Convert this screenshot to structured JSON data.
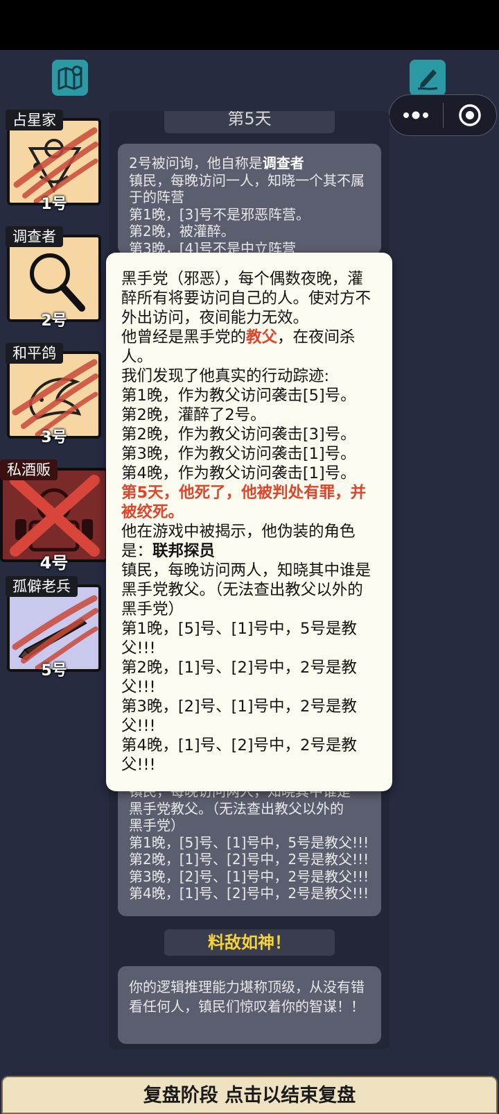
{
  "colors": {
    "background": "#262b40",
    "icon_teal": "#2b9aa5",
    "popup_bg": "#fcfbef",
    "highlight_red": "#e0442a",
    "verdict_yellow": "#f5d33a",
    "bottom_bar": "#efe2c0"
  },
  "toolbar": {
    "left_icon": "map-pin-icon",
    "right_icon": "pen-edit-icon",
    "more_icon": "more-dots-icon",
    "target_icon": "target-circle-icon"
  },
  "players": [
    {
      "role": "占星家",
      "number": "1号",
      "icon": "sextant-icon",
      "state": "clawed",
      "bg": "#f6d7a4"
    },
    {
      "role": "调查者",
      "number": "2号",
      "icon": "magnifier-icon",
      "state": "alive",
      "bg": "#f6d7a4"
    },
    {
      "role": "和平鸽",
      "number": "3号",
      "icon": "dove-icon",
      "state": "clawed",
      "bg": "#f6d7a4"
    },
    {
      "role": "私酒贩",
      "number": "4号",
      "icon": "bootlegger-icon",
      "state": "executed",
      "bg": "#7b2a2a"
    },
    {
      "role": "孤僻老兵",
      "number": "5号",
      "icon": "rifle-icon",
      "state": "clawed",
      "bg": "#c9c9ee"
    }
  ],
  "log": {
    "day_header": "第5天",
    "entry_top": {
      "line1_prefix": "2号被问询，他自称是",
      "line1_role": "调查者",
      "desc": "镇民，每晚访问一人，知晓一个其不属于的阵营",
      "n1": "第1晚，[3]号不是邪恶阵营。",
      "n2": "第2晚，被灌醉。",
      "n3": "第3晚，[4]号不是中立阵营"
    },
    "entry_bottom": {
      "l0": "镇民，每晚访问两人，知晓其中谁是",
      "l1": "黑手党教父。（无法查出教父以外的",
      "l2": "黑手党）",
      "n1": "第1晚，[5]号、[1]号中，5号是教父!!!",
      "n2": "第2晚，[1]号、[2]号中，2号是教父!!!",
      "n3": "第3晚，[2]号、[1]号中，2号是教父!!!",
      "n4": "第4晚，[1]号、[2]号中，2号是教父!!!"
    },
    "verdict": "料敌如神！",
    "verdict_text": "你的逻辑推理能力堪称顶级，从没有错看任何人，镇民们惊叹着你的智谋！！"
  },
  "popup": {
    "intro": "黑手党（邪恶），每个偶数夜晚，灌醉所有将要访问自己的人。使对方不外出访问，夜间能力无效。",
    "former_prefix": "他曾经是黑手党的",
    "former_role": "教父",
    "former_suffix": "，在夜间杀人。",
    "track_title": "我们发现了他真实的行动踪迹:",
    "tracks": [
      "第1晚，作为教父访问袭击[5]号。",
      "第2晚，灌醉了2号。",
      "第2晚，作为教父访问袭击[3]号。",
      "第3晚，作为教父访问袭击[1]号。",
      "第4晚，作为教父访问袭击[1]号。"
    ],
    "death": "第5天，他死了，他被判处有罪，并被绞死。",
    "disguise_prefix": "他在游戏中被揭示，他伪装的角色是：",
    "disguise_role": "联邦探员",
    "disguise_desc": "镇民，每晚访问两人，知晓其中谁是黑手党教父。（无法查出教父以外的黑手党）",
    "checks": [
      "第1晚，[5]号、[1]号中，5号是教父!!!",
      "第2晚，[1]号、[2]号中，2号是教父!!!",
      "第3晚，[2]号、[1]号中，2号是教父!!!",
      "第4晚，[1]号、[2]号中，2号是教父!!!"
    ]
  },
  "bottom_button": "复盘阶段 点击以结束复盘"
}
